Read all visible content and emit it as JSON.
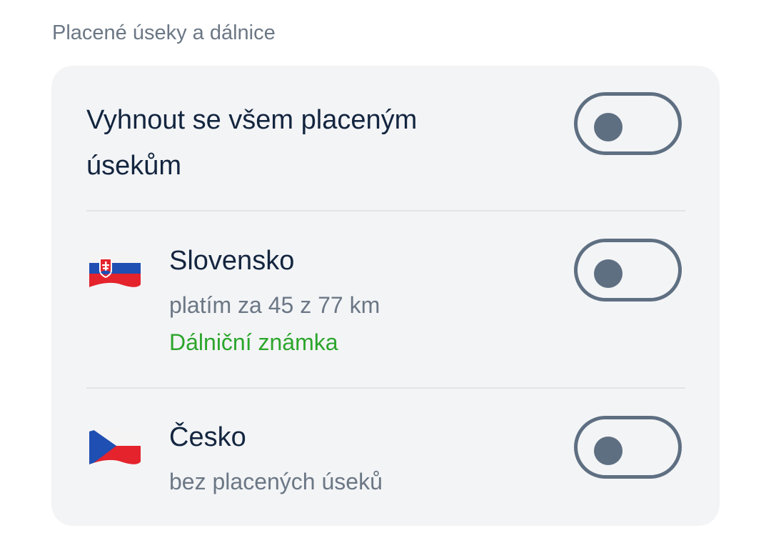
{
  "section": {
    "title": "Placené úseky a dálnice"
  },
  "avoid_all": {
    "label": "Vyhnout se všem placeným úsekům",
    "enabled": false
  },
  "countries": [
    {
      "name": "Slovensko",
      "flag_icon": "slovakia-flag-icon",
      "subtitle": "platím za 45 z 77 km",
      "link": "Dálniční známka",
      "enabled": false
    },
    {
      "name": "Česko",
      "flag_icon": "czechia-flag-icon",
      "subtitle": "bez placených úseků",
      "enabled": false
    }
  ],
  "colors": {
    "link_green": "#2ca52c",
    "toggle_gray": "#5f6f82",
    "card_bg": "#f3f4f6",
    "text_dark": "#13253f",
    "text_muted": "#6b7785"
  }
}
